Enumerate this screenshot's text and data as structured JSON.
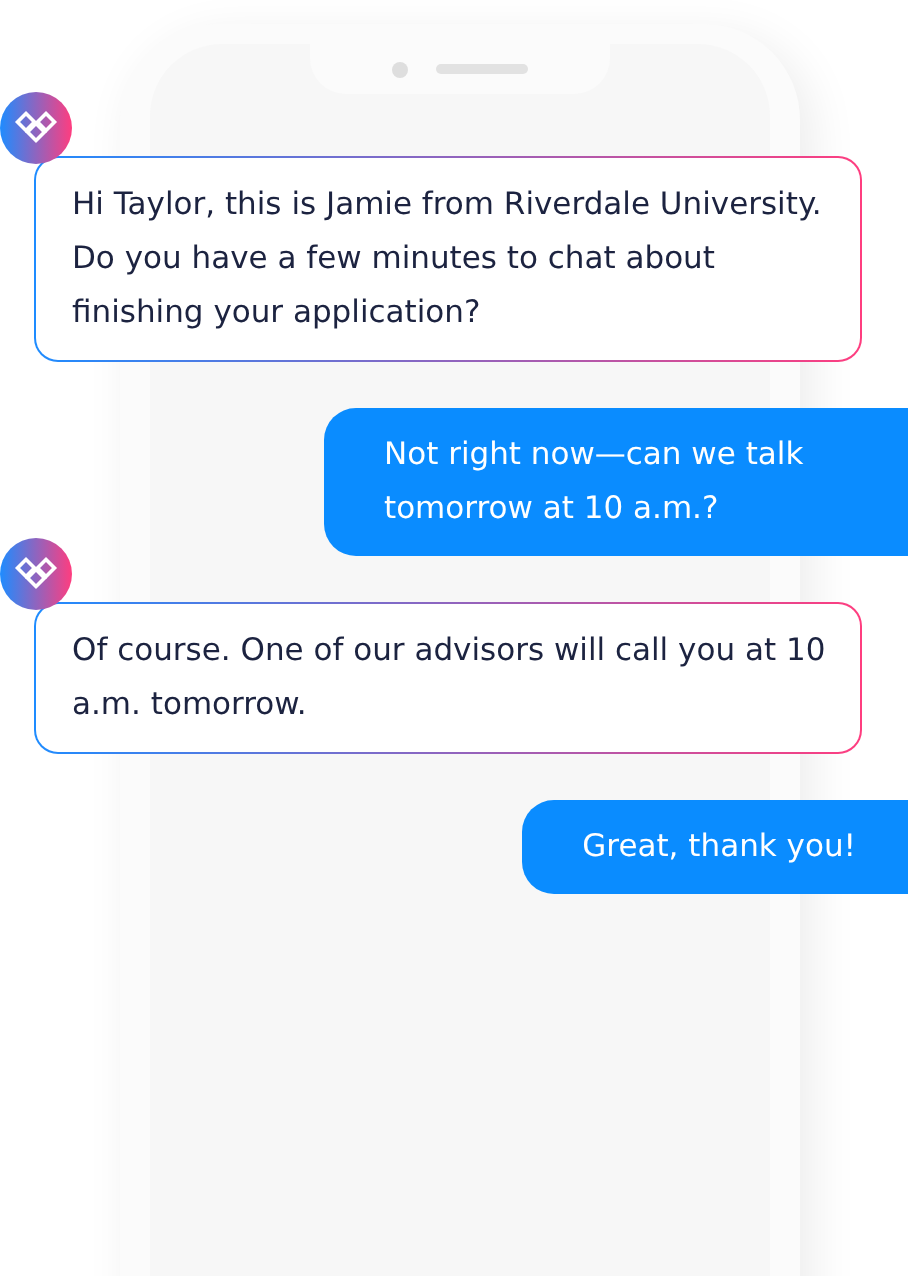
{
  "messages": [
    {
      "kind": "incoming",
      "text": "Hi Taylor, this is Jamie from Riverdale University. Do you have a few minutes to chat about finishing your application?"
    },
    {
      "kind": "outgoing",
      "text": "Not right now—can we talk tomorrow at 10 a.m.?"
    },
    {
      "kind": "incoming",
      "text": "Of course. One of our advisors will call you at 10 a.m. tomorrow."
    },
    {
      "kind": "outgoing",
      "text": "Great, thank you!"
    }
  ]
}
